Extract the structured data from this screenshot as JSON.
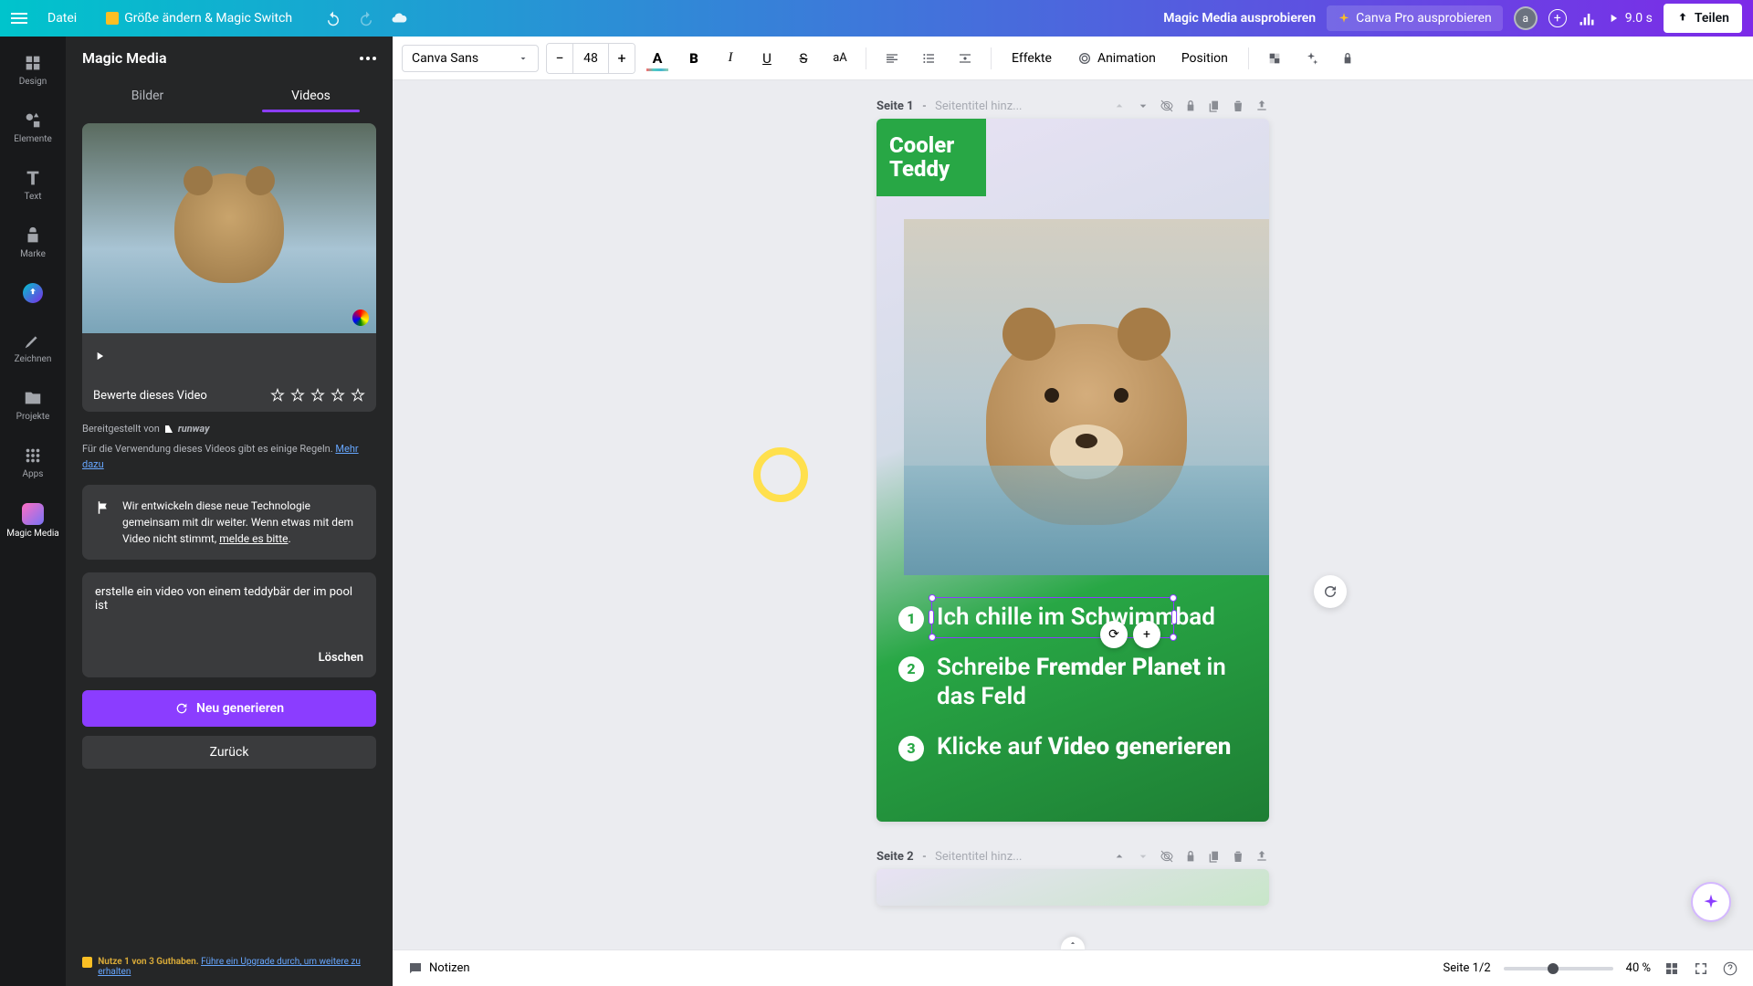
{
  "topbar": {
    "file": "Datei",
    "resize": "Größe ändern & Magic Switch",
    "try_magic": "Magic Media ausprobieren",
    "try_pro": "Canva Pro ausprobieren",
    "avatar_initial": "a",
    "duration": "9.0 s",
    "share": "Teilen"
  },
  "nav": {
    "design": "Design",
    "elements": "Elemente",
    "text": "Text",
    "brand": "Marke",
    "uploads": "",
    "draw": "Zeichnen",
    "projects": "Projekte",
    "apps": "Apps",
    "magic_media": "Magic Media"
  },
  "panel": {
    "title": "Magic Media",
    "tab_images": "Bilder",
    "tab_videos": "Videos",
    "rate_label": "Bewerte dieses Video",
    "provided_by": "Bereitgestellt von",
    "runway": "runway",
    "rules_text": "Für die Verwendung dieses Videos gibt es einige Regeln.",
    "rules_link": "Mehr dazu",
    "info_text": "Wir entwickeln diese neue Technologie gemeinsam mit dir weiter. Wenn etwas mit dem Video nicht stimmt, ",
    "info_link": "melde es bitte",
    "prompt": "erstelle ein video von einem teddybär der im pool ist",
    "clear": "Löschen",
    "generate": "Neu generieren",
    "back": "Zurück",
    "credits_text": "Nutze 1 von 3 Guthaben.",
    "credits_link": "Führe ein Upgrade durch, um weitere zu erhalten"
  },
  "context": {
    "font": "Canva Sans",
    "size": "48",
    "effects": "Effekte",
    "animation": "Animation",
    "position": "Position"
  },
  "page1": {
    "label": "Seite 1",
    "sep": " - ",
    "title_placeholder": "Seitentitel hinz...",
    "canvas_title_l1": "Cooler",
    "canvas_title_l2": "Teddy",
    "step1": "Ich chille im Schwimmbad",
    "step2_a": "Schreibe ",
    "step2_b": "Fremder Planet",
    "step2_c": " in das Feld",
    "step3_a": "Klicke auf ",
    "step3_b": "Video generieren"
  },
  "page2": {
    "label": "Seite 2",
    "sep": " - ",
    "title_placeholder": "Seitentitel hinz..."
  },
  "footer": {
    "notes": "Notizen",
    "page_indicator": "Seite 1/2",
    "zoom": "40 %"
  }
}
